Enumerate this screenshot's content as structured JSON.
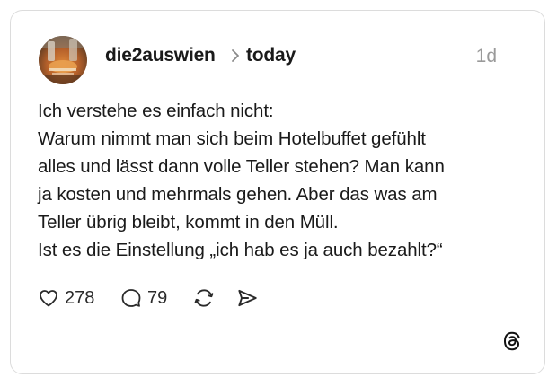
{
  "post": {
    "author": {
      "username": "die2auswien",
      "avatar_icon": "avatar-photo"
    },
    "topic": "today",
    "separator_icon": "chevron-right-icon",
    "timestamp": "1d",
    "text_lines": [
      "Ich verstehe es einfach nicht:",
      "Warum nimmt man sich beim Hotelbuffet gefühlt",
      "alles und lässt dann volle Teller stehen? Man kann",
      "ja kosten und mehrmals gehen. Aber das was am",
      "Teller übrig bleibt, kommt in den Müll.",
      "Ist es die Einstellung „ich hab es ja auch bezahlt?“"
    ],
    "actions": {
      "like": {
        "icon": "heart-icon",
        "count": "278"
      },
      "reply": {
        "icon": "comment-icon",
        "count": "79"
      },
      "repost": {
        "icon": "repost-icon"
      },
      "share": {
        "icon": "send-icon"
      }
    }
  },
  "branding": {
    "logo": "threads-logo-icon"
  },
  "colors": {
    "text": "#1a1a1a",
    "muted": "#9a9a9a",
    "border": "#dcdcdc",
    "background": "#ffffff"
  }
}
